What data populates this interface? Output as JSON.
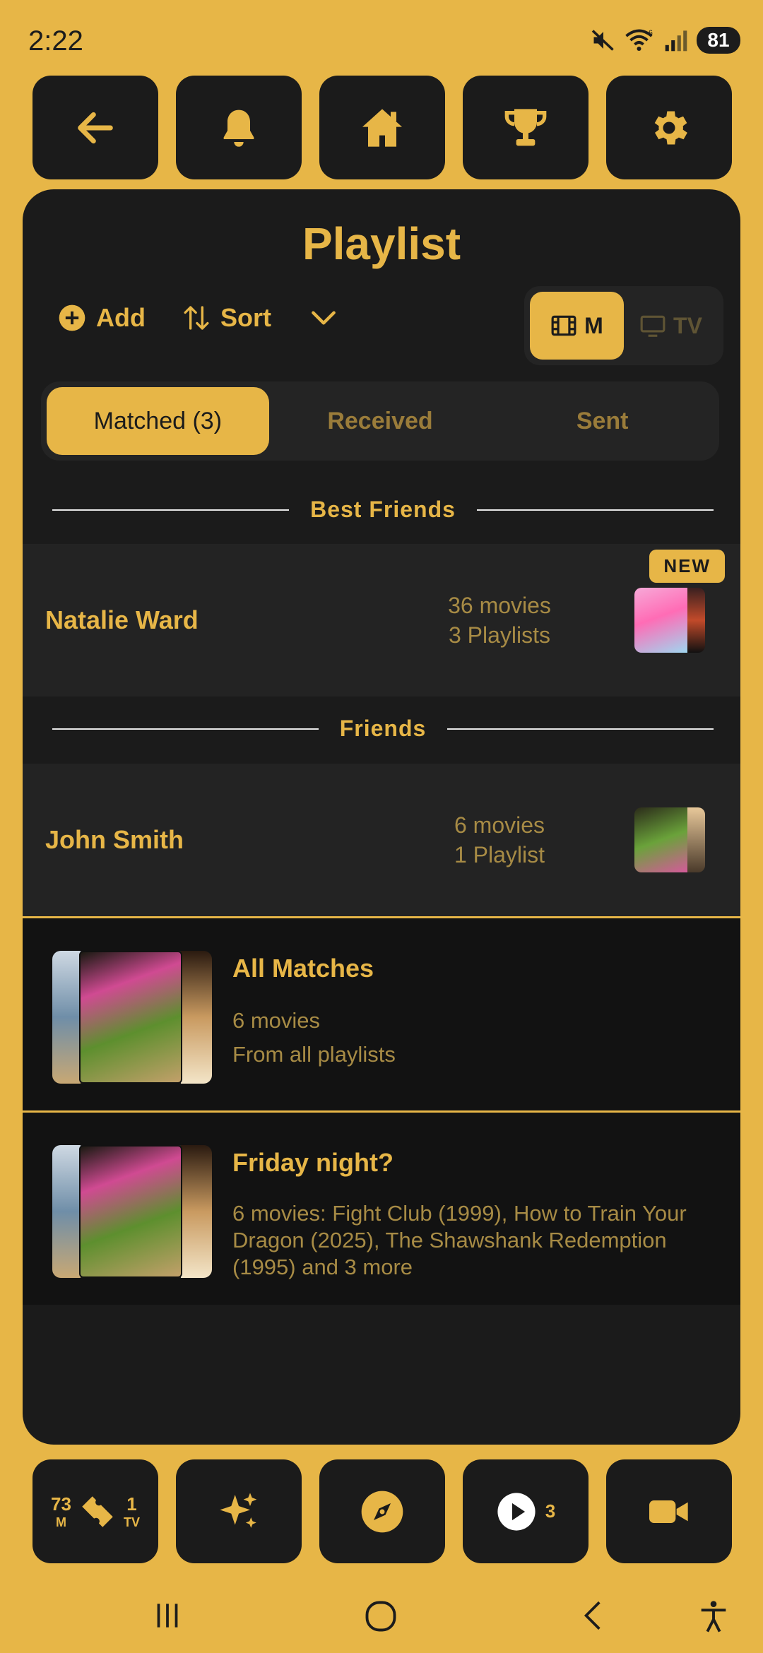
{
  "status": {
    "time": "2:22",
    "battery": "81",
    "wifi_badge": "6"
  },
  "colors": {
    "accent": "#E7B647",
    "panel": "#1b1b1b",
    "row": "#232323",
    "card": "#121212"
  },
  "top_nav": {
    "icons": [
      "back-arrow-icon",
      "bell-icon",
      "home-icon",
      "trophy-icon",
      "gear-icon"
    ]
  },
  "page": {
    "title": "Playlist"
  },
  "toolbar": {
    "add_label": "Add",
    "sort_label": "Sort"
  },
  "media_toggle": {
    "movies_label": "M",
    "tv_label": "TV",
    "selected": "M"
  },
  "tabs": [
    {
      "label": "Matched (3)",
      "active": true
    },
    {
      "label": "Received",
      "active": false
    },
    {
      "label": "Sent",
      "active": false
    }
  ],
  "sections": [
    {
      "title": "Best Friends",
      "friends": [
        {
          "name": "Natalie Ward",
          "movies": "36 movies",
          "playlists": "3 Playlists",
          "badge": "NEW"
        }
      ]
    },
    {
      "title": "Friends",
      "friends": [
        {
          "name": "John Smith",
          "movies": "6 movies",
          "playlists": "1 Playlist"
        }
      ]
    }
  ],
  "playlists": [
    {
      "title": "All Matches",
      "line1": "6 movies",
      "line2": "From all playlists"
    },
    {
      "title": "Friday night?",
      "description": "6 movies: Fight Club (1999), How to Train Your Dragon (2025), The Shawshank Redemption (1995) and 3 more"
    }
  ],
  "bottom_nav": {
    "tickets": {
      "movies_count": "73",
      "movies_unit": "M",
      "tv_count": "1",
      "tv_unit": "TV"
    },
    "play_count": "3"
  }
}
